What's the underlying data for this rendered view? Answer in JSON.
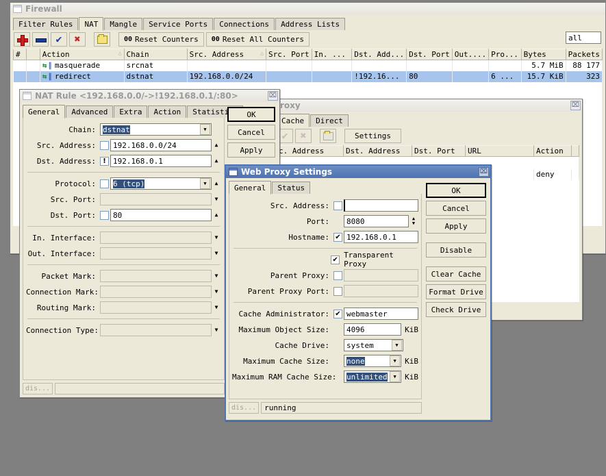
{
  "firewall": {
    "title": "Firewall",
    "close_label": "⌧",
    "tabs": [
      {
        "label": "Filter Rules",
        "selected": false
      },
      {
        "label": "NAT",
        "selected": true
      },
      {
        "label": "Mangle",
        "selected": false
      },
      {
        "label": "Service Ports",
        "selected": false
      },
      {
        "label": "Connections",
        "selected": false
      },
      {
        "label": "Address Lists",
        "selected": false
      }
    ],
    "toolbar": {
      "add": "+",
      "remove": "−",
      "enable": "✔",
      "disable": "✖",
      "comment": "folder",
      "reset_counters": "Reset Counters",
      "reset_all_counters": "Reset All Counters",
      "counter_prefix": "00",
      "filter_value": "all"
    },
    "columns": [
      "#",
      "",
      "Action",
      "Chain",
      "Src. Address",
      "Src. Port",
      "In. ...",
      "Dst. Add...",
      "Dst. Port",
      "Out....",
      "Pro...",
      "Bytes",
      "Packets"
    ],
    "rows": [
      {
        "num": "",
        "flag": "",
        "action": "masquerade",
        "chain": "srcnat",
        "src_address": "",
        "src_port": "",
        "in_iface": "",
        "dst_address": "",
        "dst_port": "",
        "out_iface": "",
        "protocol": "",
        "bytes": "5.7 MiB",
        "packets": "88 177",
        "selected": false
      },
      {
        "num": "",
        "flag": "",
        "action": "redirect",
        "chain": "dstnat",
        "src_address": "192.168.0.0/24",
        "src_port": "",
        "in_iface": "",
        "dst_address": "!192.16...",
        "dst_port": "80",
        "out_iface": "",
        "protocol": "6 ...",
        "bytes": "15.7 KiB",
        "packets": "323",
        "selected": true
      }
    ]
  },
  "webproxy_window": {
    "title": "Web Proxy",
    "title_visible": "roxy",
    "close_label": "⌧",
    "tabs": [
      {
        "label": "Cache",
        "selected": true
      },
      {
        "label": "Direct",
        "selected": false
      }
    ],
    "toolbar": {
      "enable": "✔",
      "disable": "✖",
      "comment": "folder",
      "settings": "Settings"
    },
    "columns": [
      "c. Address",
      "Dst. Address",
      "Dst. Port",
      "URL",
      "Action",
      ""
    ],
    "rows": [
      {
        "src_address": "",
        "dst_address": "",
        "dst_port": "",
        "url": "",
        "action": "deny"
      }
    ]
  },
  "nat_rule": {
    "title": "NAT Rule <192.168.0.0/->!192.168.0.1/:80>",
    "close_label": "⌧",
    "tabs": [
      {
        "label": "General",
        "selected": true
      },
      {
        "label": "Advanced",
        "selected": false
      },
      {
        "label": "Extra",
        "selected": false
      },
      {
        "label": "Action",
        "selected": false
      },
      {
        "label": "Statistics",
        "selected": false
      }
    ],
    "fields": {
      "chain": {
        "label": "Chain:",
        "value": "dstnat",
        "highlighted": true
      },
      "src_address": {
        "label": "Src. Address:",
        "value": "192.168.0.0/24",
        "check": "",
        "negated": false
      },
      "dst_address": {
        "label": "Dst. Address:",
        "value": "192.168.0.1",
        "check": "!",
        "negated": true
      },
      "protocol": {
        "label": "Protocol:",
        "value": "6 (tcp)",
        "check": "",
        "highlighted": true
      },
      "src_port": {
        "label": "Src. Port:",
        "value": "",
        "disabled": true
      },
      "dst_port": {
        "label": "Dst. Port:",
        "value": "80",
        "check": ""
      },
      "in_interface": {
        "label": "In. Interface:",
        "value": "",
        "disabled": true
      },
      "out_interface": {
        "label": "Out. Interface:",
        "value": "",
        "disabled": true
      },
      "packet_mark": {
        "label": "Packet Mark:",
        "value": "",
        "disabled": true
      },
      "connection_mark": {
        "label": "Connection Mark:",
        "value": "",
        "disabled": true
      },
      "routing_mark": {
        "label": "Routing Mark:",
        "value": "",
        "disabled": true
      },
      "connection_type": {
        "label": "Connection Type:",
        "value": "",
        "disabled": true
      }
    },
    "buttons": {
      "ok": "OK",
      "cancel": "Cancel",
      "apply": "Apply"
    },
    "status": {
      "left": "dis...",
      "text": ""
    }
  },
  "proxy_settings": {
    "title": "Web Proxy Settings",
    "close_label": "⌧",
    "tabs": [
      {
        "label": "General",
        "selected": true
      },
      {
        "label": "Status",
        "selected": false
      }
    ],
    "fields": {
      "src_address": {
        "label": "Src. Address:",
        "value": "",
        "checked": false
      },
      "port": {
        "label": "Port:",
        "value": "8080"
      },
      "hostname": {
        "label": "Hostname:",
        "value": "192.168.0.1",
        "checked": true
      },
      "transparent_proxy": {
        "label": "Transparent Proxy",
        "checked": true
      },
      "parent_proxy": {
        "label": "Parent Proxy:",
        "value": "",
        "checked": false
      },
      "parent_proxy_port": {
        "label": "Parent Proxy Port:",
        "value": "",
        "checked": false
      },
      "cache_administrator": {
        "label": "Cache Administrator:",
        "value": "webmaster",
        "checked": true
      },
      "maximum_object_size": {
        "label": "Maximum Object Size:",
        "value": "4096",
        "unit": "KiB"
      },
      "cache_drive": {
        "label": "Cache Drive:",
        "value": "system"
      },
      "maximum_cache_size": {
        "label": "Maximum Cache Size:",
        "value": "none",
        "unit": "KiB",
        "highlighted": true
      },
      "maximum_ram_cache_size": {
        "label": "Maximum RAM Cache Size:",
        "value": "unlimited",
        "unit": "KiB",
        "highlighted": true
      }
    },
    "buttons": {
      "ok": "OK",
      "cancel": "Cancel",
      "apply": "Apply",
      "disable": "Disable",
      "clear_cache": "Clear Cache",
      "format_drive": "Format Drive",
      "check_drive": "Check Drive"
    },
    "status": {
      "left": "dis...",
      "text": "running"
    }
  }
}
